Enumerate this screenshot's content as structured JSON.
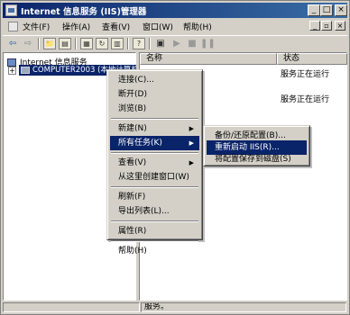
{
  "window": {
    "title": "Internet 信息服务 (IIS)管理器",
    "controls": {
      "minimize": "_",
      "maximize": "□",
      "close": "×"
    }
  },
  "menubar": {
    "items": [
      "文件(F)",
      "操作(A)",
      "查看(V)",
      "窗口(W)",
      "帮助(H)"
    ],
    "mdi_controls": {
      "minimize": "_",
      "restore": "▫",
      "close": "×"
    }
  },
  "toolbar": {
    "icons": [
      "back-arrow-icon",
      "forward-arrow-icon",
      "up-folder-icon",
      "console-tree-icon",
      "properties-icon",
      "refresh-icon",
      "export-icon",
      "help-icon",
      "computer-icon",
      "play-icon",
      "stop-icon",
      "pause-icon"
    ]
  },
  "tree": {
    "root": "Internet 信息服务",
    "expander": "+",
    "selected_node": "COMPUTER2003 (本地计算机)"
  },
  "list": {
    "columns": [
      "名称",
      "状态"
    ],
    "rows": [
      {
        "name": "",
        "status": "服务正在运行"
      },
      {
        "name": "",
        "status": "服务正在运行"
      }
    ]
  },
  "status_bar": {
    "text": "服务。"
  },
  "context_menu": {
    "items": [
      {
        "label": "连接(C)...",
        "submenu": false
      },
      {
        "label": "断开(D)",
        "submenu": false
      },
      {
        "label": "浏览(B)",
        "submenu": false
      },
      {
        "separator": true
      },
      {
        "label": "新建(N)",
        "submenu": true,
        "arrow": "▶"
      },
      {
        "label": "所有任务(K)",
        "submenu": true,
        "arrow": "▶",
        "highlighted": true
      },
      {
        "separator": true
      },
      {
        "label": "查看(V)",
        "submenu": true,
        "arrow": "▶"
      },
      {
        "label": "从这里创建窗口(W)",
        "submenu": false
      },
      {
        "separator": true
      },
      {
        "label": "刷新(F)",
        "submenu": false
      },
      {
        "label": "导出列表(L)...",
        "submenu": false
      },
      {
        "separator": true
      },
      {
        "label": "属性(R)",
        "submenu": false
      },
      {
        "separator": true
      },
      {
        "label": "帮助(H)",
        "submenu": false
      }
    ]
  },
  "submenu": {
    "items": [
      {
        "label": "备份/还原配置(B)..."
      },
      {
        "label": "重新启动 IIS(R)...",
        "highlighted": true
      },
      {
        "label": "将配置保存到磁盘(S)"
      }
    ]
  },
  "colors": {
    "highlight": "#0a246a",
    "chrome": "#d4d0c8",
    "title_gradient_end": "#3a6ea5"
  }
}
